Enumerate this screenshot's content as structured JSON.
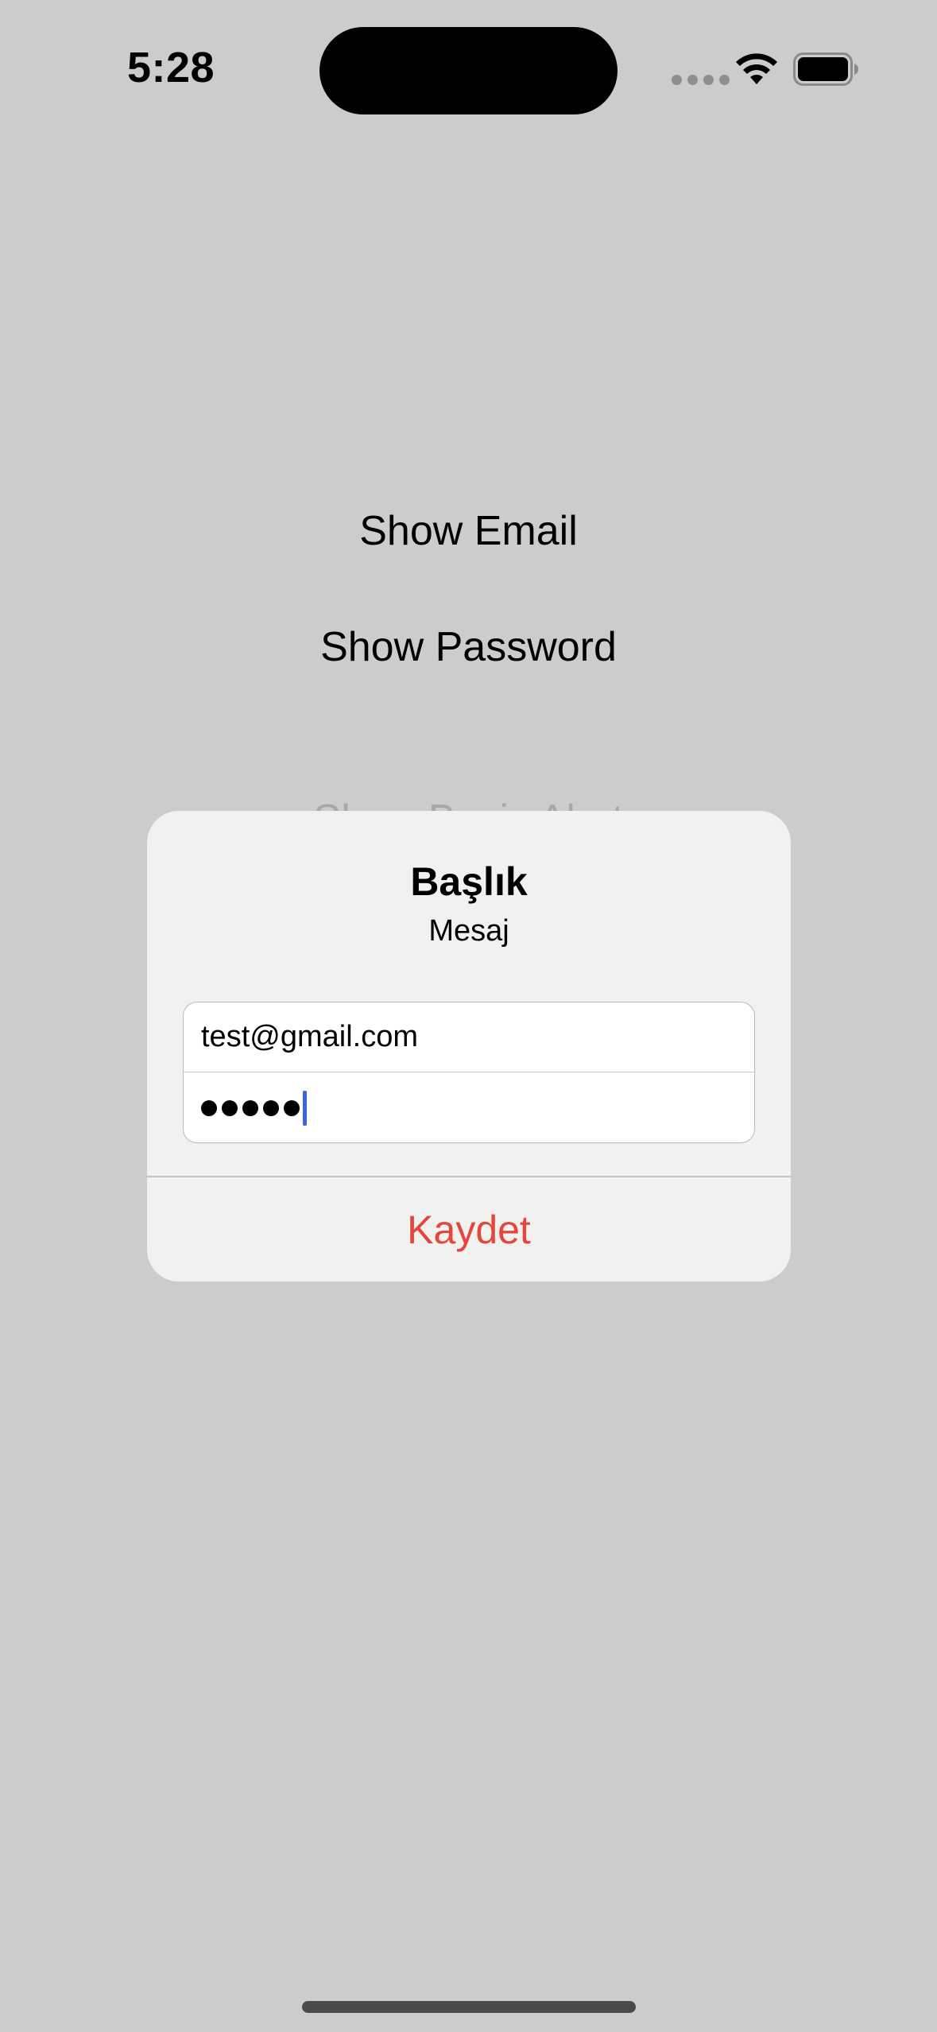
{
  "status_bar": {
    "time": "5:28",
    "icons": [
      "cellular-signal-icon",
      "wifi-icon",
      "battery-icon"
    ]
  },
  "background": {
    "buttons": [
      {
        "label": "Show Email"
      },
      {
        "label": "Show Password"
      },
      {
        "label": "Show Basic Alert"
      }
    ]
  },
  "alert": {
    "title": "Başlık",
    "message": "Mesaj",
    "email_value": "test@gmail.com",
    "password_masked_length": 5,
    "action_label": "Kaydet",
    "action_color": "#e5463b"
  },
  "colors": {
    "background": "#cccccc",
    "alert_background": "#f1f1f0",
    "caret": "#3d63e0"
  }
}
